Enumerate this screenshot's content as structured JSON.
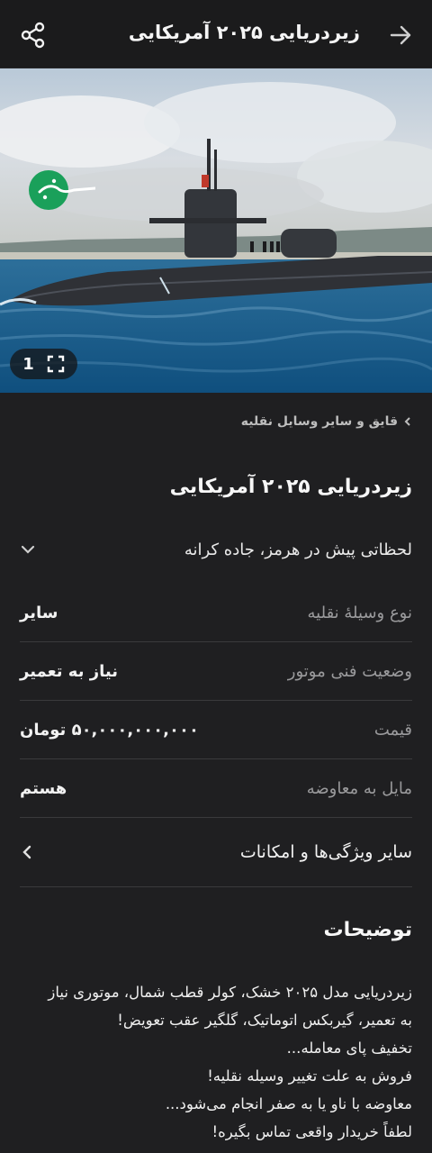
{
  "header": {
    "title": "زیردریایی ۲۰۲۵ آمریکایی"
  },
  "gallery": {
    "count": "1",
    "brand_text": "سبزوزی"
  },
  "breadcrumb": {
    "label": "قایق و سایر وسایل نقلیه"
  },
  "ad": {
    "title": "زیردریایی ۲۰۲۵ آمریکایی",
    "location": "لحظاتی پیش در هرمز، جاده کرانه"
  },
  "specs": [
    {
      "label": "نوع وسیلهٔ نقلیه",
      "value": "سایر"
    },
    {
      "label": "وضعیت فنی موتور",
      "value": "نیاز به تعمیر"
    },
    {
      "label": "قیمت",
      "value": "۵۰,۰۰۰,۰۰۰,۰۰۰ تومان"
    },
    {
      "label": "مایل به معاوضه",
      "value": "هستم"
    }
  ],
  "more_features": "سایر ویژگی‌ها و امکانات",
  "description": {
    "title": "توضیحات",
    "lines": [
      "زیردریایی مدل ۲۰۲۵ خشک، کولر قطب شمال، موتوری نیاز",
      "به تعمیر، گیربکس اتوماتیک، گلگیر عقب تعویض!",
      " تخفیف پای معامله...",
      "فروش به علت تغییر وسیله نقلیه!",
      "معاوضه با ناو یا به صفر انجام می‌شود...",
      "لطفاً خریدار واقعی تماس بگیره!"
    ]
  },
  "colors": {
    "background": "#1f1f21",
    "appbar": "#1b1b1c",
    "divider": "#3a3a3c",
    "muted_text": "#9a9a9c",
    "logo_green": "#1aa05a"
  }
}
